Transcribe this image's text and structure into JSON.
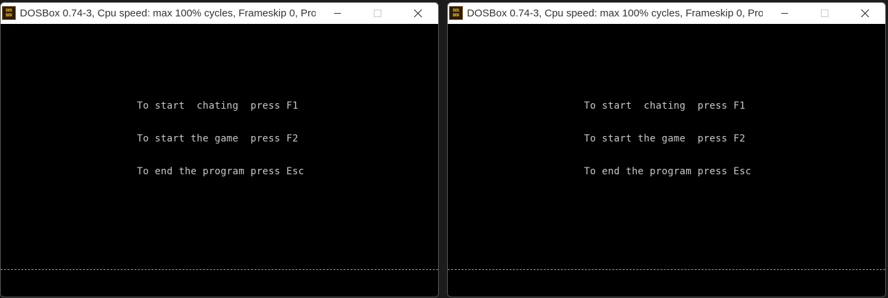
{
  "windows": [
    {
      "title": "DOSBox 0.74-3, Cpu speed: max 100% cycles, Frameskip  0, Pro...",
      "icon_text": [
        "DOS",
        "BOX"
      ],
      "menu_lines": [
        "To start  chating  press F1",
        "To start the game  press F2",
        "To end the program press Esc"
      ]
    },
    {
      "title": "DOSBox 0.74-3, Cpu speed: max 100% cycles, Frameskip  0, Pro...",
      "icon_text": [
        "DOS",
        "BOX"
      ],
      "menu_lines": [
        "To start  chating  press F1",
        "To start the game  press F2",
        "To end the program press Esc"
      ]
    }
  ],
  "icons": {
    "app": "dosbox-app-icon",
    "minimize": "minimize-icon",
    "maximize": "maximize-icon",
    "close": "close-icon"
  },
  "colors": {
    "screen_bg": "#000000",
    "text": "#c8c8c8",
    "titlebar_bg": "#ffffff",
    "icon_yellow": "#f2c21a"
  }
}
